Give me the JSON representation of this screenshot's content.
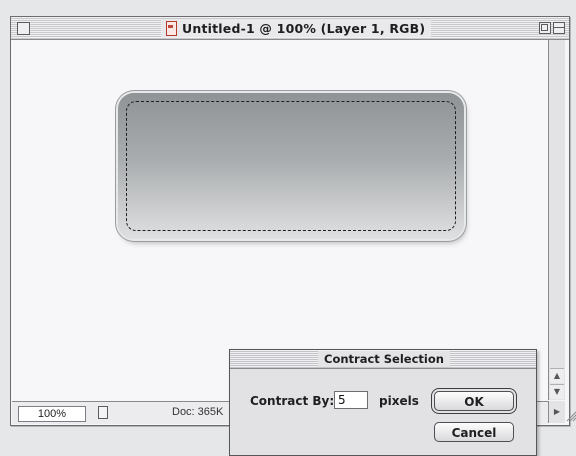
{
  "window": {
    "title": "Untitled-1 @ 100% (Layer 1, RGB)"
  },
  "status_bar": {
    "zoom": "100%",
    "doc_info": "Doc: 365K"
  },
  "dialog": {
    "title": "Contract Selection",
    "field_label": "Contract By:",
    "field_value": "5",
    "unit_label": "pixels",
    "ok_label": "OK",
    "cancel_label": "Cancel"
  },
  "icons": [
    "close-box-icon",
    "document-icon",
    "zoom-box-icon",
    "collapse-box-icon",
    "scroll-up-arrow-icon",
    "scroll-down-arrow-icon",
    "scroll-right-arrow-icon",
    "grow-box-icon",
    "doc-popup-icon"
  ],
  "colors": {
    "canvas": "#f7f7f9",
    "button_gradient_top": "#8f9396",
    "button_gradient_bottom": "#dfe0e1"
  }
}
